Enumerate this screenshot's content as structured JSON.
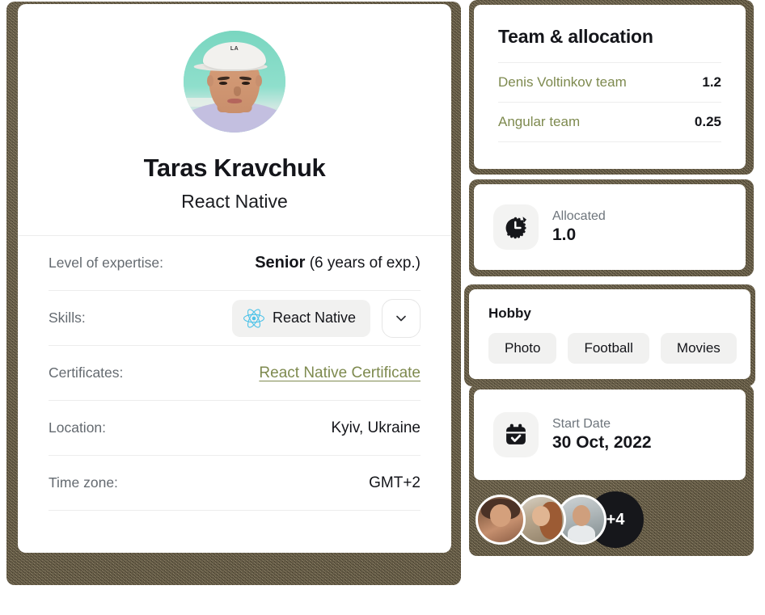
{
  "profile": {
    "avatar_alt": "Taras Kravchuk portrait",
    "name": "Taras Kravchuk",
    "role": "React Native",
    "details": [
      {
        "label": "Level of expertise:",
        "value_strong": "Senior",
        "value_rest": " (6 years of exp.)"
      },
      {
        "label": "Skills:",
        "skill_chip": "React Native",
        "chip_icon": "react-logo-icon",
        "expand_icon": "chevron-down-icon"
      },
      {
        "label": "Certificates:",
        "link_text": "React Native Certificate"
      },
      {
        "label": "Location:",
        "value": "Kyiv, Ukraine"
      },
      {
        "label": "Time zone:",
        "value": "GMT+2"
      }
    ]
  },
  "team": {
    "title": "Team & allocation",
    "rows": [
      {
        "name": "Denis Voltinkov team",
        "allocation": "1.2"
      },
      {
        "name": "Angular team",
        "allocation": "0.25"
      }
    ]
  },
  "allocated": {
    "icon": "stopwatch-icon",
    "label": "Allocated",
    "value": "1.0"
  },
  "hobby": {
    "title": "Hobby",
    "tags": [
      "Photo",
      "Football",
      "Movies"
    ]
  },
  "start_date": {
    "icon": "calendar-check-icon",
    "label": "Start Date",
    "value": "30 Oct, 2022"
  },
  "members": {
    "overflow_label": "+4",
    "avatars": [
      "member-avatar-1",
      "member-avatar-2",
      "member-avatar-3"
    ]
  },
  "colors": {
    "accent_olive": "#7e8a4f",
    "text_primary": "#14151a",
    "text_muted": "#646a70",
    "chip_bg": "#f1f1f0",
    "backdrop": "#6b5f44",
    "dark_badge": "#16171b",
    "react_blue": "#61dafb"
  }
}
